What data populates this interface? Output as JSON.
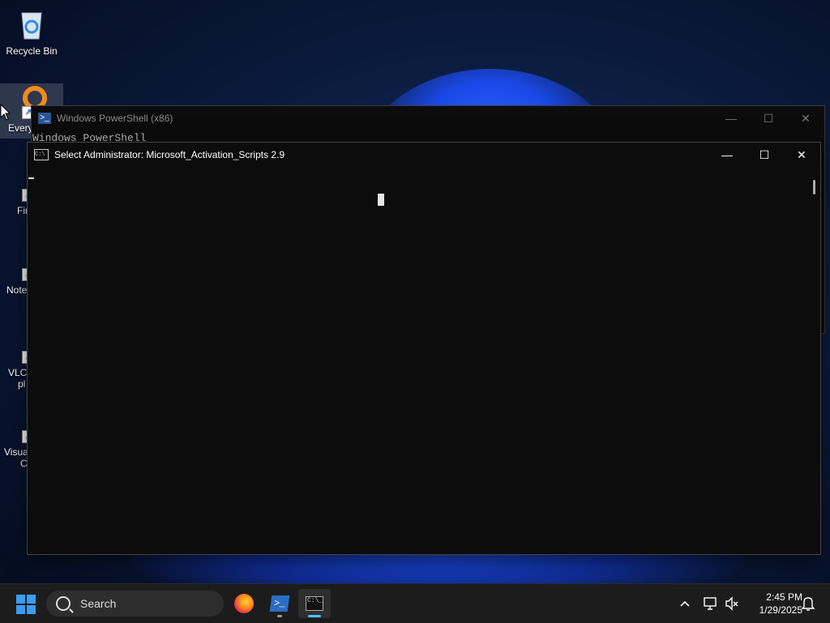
{
  "desktop": {
    "icons": [
      {
        "label": "Recycle Bin"
      },
      {
        "label": "Every"
      },
      {
        "label": "Fir"
      },
      {
        "label": "Note"
      },
      {
        "label": "VLC"
      },
      {
        "label": "pl"
      },
      {
        "label": "Visua"
      },
      {
        "label": "C"
      }
    ]
  },
  "ps_window": {
    "title": "Windows PowerShell (x86)",
    "content": "Windows PowerShell",
    "minimize": "—",
    "maximize": "☐",
    "close": "✕"
  },
  "cmd_window": {
    "title": "Select Administrator:  Microsoft_Activation_Scripts 2.9",
    "minimize": "—",
    "maximize": "☐",
    "close": "✕"
  },
  "taskbar": {
    "search_label": "Search",
    "time": "2:45 PM",
    "date": "1/29/2025",
    "apps": [
      "firefox",
      "powershell",
      "command-prompt"
    ],
    "accent": "#3a9cf4"
  }
}
